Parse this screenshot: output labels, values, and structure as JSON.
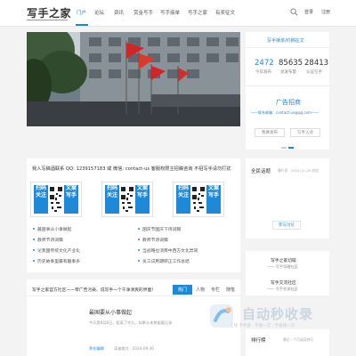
{
  "header": {
    "logo": "写手之家",
    "nav": [
      {
        "label": "门户",
        "active": true
      },
      {
        "label": "论坛",
        "active": false
      },
      {
        "label": "资讯",
        "active": false
      },
      {
        "label": "赏金写手",
        "active": false
      },
      {
        "label": "写手接单",
        "active": false
      },
      {
        "label": "写手之家",
        "active": false
      },
      {
        "label": "有奖征文",
        "active": false
      }
    ],
    "login": "登录",
    "register": "注册",
    "search_icon": "search-icon"
  },
  "stats": {
    "title": "写手接单/约稿征文",
    "items": [
      {
        "value": "2472",
        "label": "今日发布"
      },
      {
        "value": "85635",
        "label": "总发布量"
      },
      {
        "value": "28413",
        "label": "认证写手"
      }
    ],
    "ad_title": "广告招商",
    "ad_contact": "——联系邮箱：contact-us@qq.com——",
    "btn_publish": "我要发布",
    "btn_join": "写手入驻"
  },
  "recruit": {
    "title": "我人写稿酒联系 QQ: 1239157183 或 微信: contact-us 客服权限主招稿咨询 不招写手请勿打扰",
    "qr_tiles": [
      {
        "left": "扫码关注",
        "right": "文案写手"
      },
      {
        "left": "扫码关注",
        "right": "文案写手"
      },
      {
        "left": "扫码关注",
        "right": "文案写手"
      }
    ],
    "bullets_left": [
      "最国事从小事做起",
      "教师节诗词稿",
      "论我国传统文化产业化",
      "历史故事里最有趣事多"
    ],
    "bullets_right": [
      "国庆节国庆下诗词稿",
      "教师节诗词稿",
      "当战略也消费中西方文化异同",
      "员工试用期转正工作总结"
    ]
  },
  "topic": {
    "title": "全民话题",
    "meta": "最行家 · 2024-11-29 浏览",
    "btn": "参与讨论"
  },
  "topic2": {
    "line1": "写手之家切磋",
    "line2": "—— 写手切磋社区"
  },
  "topic3": {
    "line1": "写手交流社区",
    "line2": "—— 写手交流社区"
  },
  "hot": {
    "title": "排行榜",
    "meta": "最近一个月阅读排行"
  },
  "articles": {
    "header_title": "写手之家官方社区——零广告污染、说写手一个干净清爽的界面！",
    "tabs": [
      {
        "label": "热门",
        "active": true
      },
      {
        "label": "人物",
        "active": false
      },
      {
        "label": "专栏",
        "active": false
      },
      {
        "label": "随笔",
        "active": false
      }
    ],
    "item_title": "最国要从小事做起",
    "item_meta": "今天是8月8日，距离了许久，如果从本数据要记录",
    "item_author": "责任编辑",
    "item_time": "读者散文 · 2024-09-30"
  },
  "watermark": {
    "text": "自动秒收录",
    "sub": "上线 不秒收 · 不收一次 · 不收钱一次"
  },
  "colors": {
    "accent": "#1e88d9"
  }
}
